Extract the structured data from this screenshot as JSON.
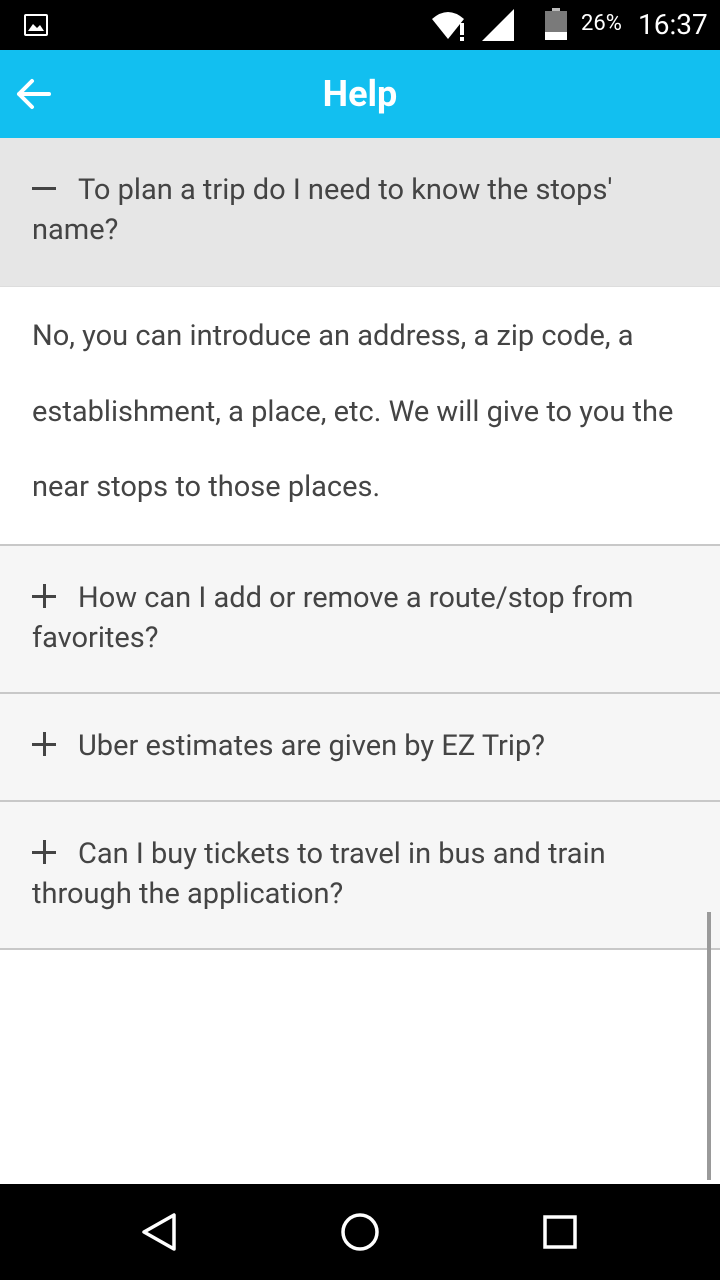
{
  "status_bar": {
    "battery": "26%",
    "time": "16:37",
    "icons": [
      "gallery-icon",
      "wifi-icon",
      "signal-icon",
      "battery-icon"
    ]
  },
  "app_bar": {
    "title": "Help",
    "back_icon": "arrow-left-icon",
    "color": "#12bff0"
  },
  "faq": [
    {
      "question": "To plan a trip do I need to know the stops' name?",
      "expanded": true,
      "toggle_icon": "minus-icon",
      "answer": "No, you can introduce an address, a zip code, a establishment, a place, etc. We will give to you the near stops to those places."
    },
    {
      "question": "How can I add or remove a route/stop from favorites?",
      "expanded": false,
      "toggle_icon": "plus-icon"
    },
    {
      "question": "Uber estimates are given by EZ Trip?",
      "expanded": false,
      "toggle_icon": "plus-icon"
    },
    {
      "question": "Can I buy tickets to travel in bus and train through the application?",
      "expanded": false,
      "toggle_icon": "plus-icon"
    }
  ],
  "nav_bar": {
    "icons": [
      "back-triangle-icon",
      "home-circle-icon",
      "recents-square-icon"
    ]
  }
}
